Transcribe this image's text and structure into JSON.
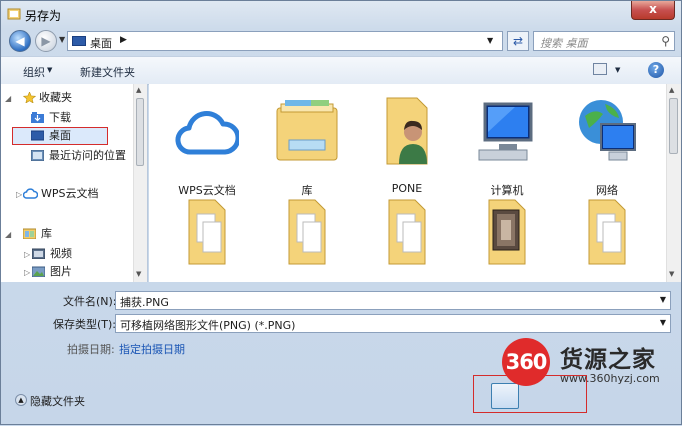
{
  "window": {
    "title": "另存为",
    "close_label": "x"
  },
  "address": {
    "location": "桌面",
    "search_placeholder": "搜索 桌面"
  },
  "toolbar": {
    "organize_label": "组织",
    "new_folder_label": "新建文件夹",
    "help_label": "?"
  },
  "nav": {
    "favorites_label": "收藏夹",
    "downloads_label": "下载",
    "desktop_label": "桌面",
    "recent_label": "最近访问的位置",
    "wps_label": "WPS云文档",
    "libraries_label": "库",
    "videos_label": "视频",
    "pictures_label": "图片"
  },
  "files": [
    {
      "label": "WPS云文档",
      "icon": "wps-cloud-icon"
    },
    {
      "label": "库",
      "icon": "library-icon"
    },
    {
      "label": "PONE",
      "icon": "user-folder-icon"
    },
    {
      "label": "计算机",
      "icon": "computer-icon"
    },
    {
      "label": "网络",
      "icon": "network-icon"
    },
    {
      "label": "",
      "icon": "folder-icon"
    },
    {
      "label": "",
      "icon": "folder-icon"
    },
    {
      "label": "",
      "icon": "folder-icon"
    },
    {
      "label": "",
      "icon": "photo-folder-icon"
    },
    {
      "label": "",
      "icon": "folder-icon"
    }
  ],
  "form": {
    "filename_label": "文件名(N):",
    "filename_value": "捕获.PNG",
    "filetype_label": "保存类型(T):",
    "filetype_value": "可移植网络图形文件(PNG) (*.PNG)",
    "date_label": "拍摄日期:",
    "date_link": "指定拍摄日期",
    "hide_folders_label": "隐藏文件夹"
  },
  "watermark": {
    "logo_text": "360",
    "title": "货源之家",
    "url": "www.360hyzj.com"
  },
  "colors": {
    "highlight_border": "#d42c2c",
    "link": "#1b56b5",
    "frame": "#c6d6e9"
  }
}
